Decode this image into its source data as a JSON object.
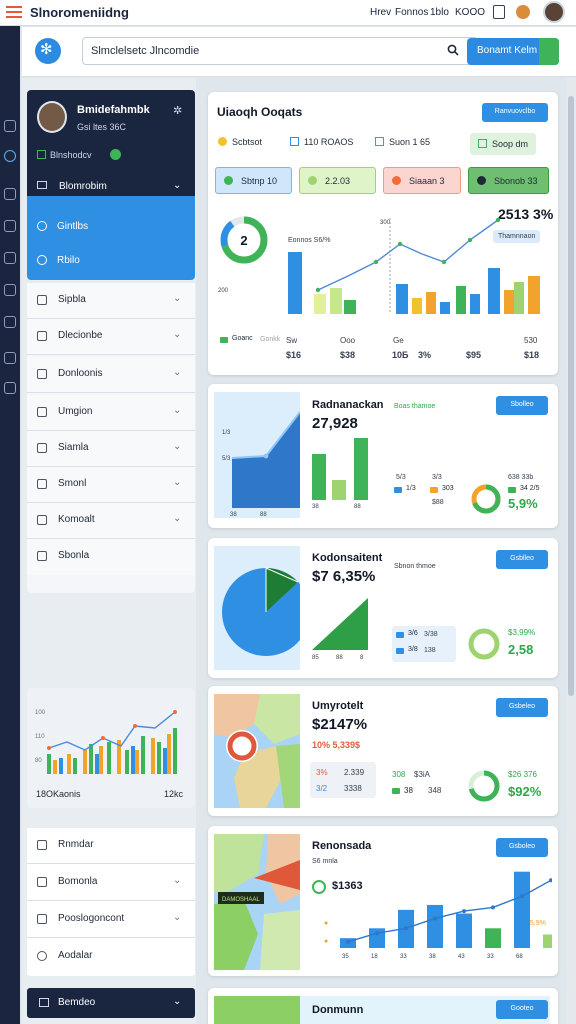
{
  "topbar": {
    "title": "Slnoromeniidng",
    "links": [
      "Hrev",
      "Fonnos",
      "1blo",
      "KOOO"
    ]
  },
  "search": {
    "value": "Slmclelsetc Jlncomdie",
    "button_label": "Bonamt Kelm"
  },
  "profile": {
    "name": "Bmidefahmbk",
    "sub": "Gsi ltes 36C",
    "status": "Blnshodcv",
    "menu_label": "Blomrobim",
    "items": [
      "Gintlbs",
      "Rbilo"
    ]
  },
  "nav": {
    "items": [
      "Sipbla",
      "Dlecionbe",
      "Donloonis",
      "Umgion",
      "Siamla",
      "Smonl",
      "Komoalt",
      "Sbonla"
    ],
    "bottom_items": [
      "Rnmdar",
      "Bomonla",
      "Pooslogoncont",
      "Aodalar"
    ],
    "footer_label": "Bemdeo"
  },
  "side_chart": {
    "label": "18OKaonis",
    "value": "12kc",
    "axis": [
      "100",
      "110",
      "80"
    ]
  },
  "card1": {
    "title": "Uiaoqh Ooqats",
    "button": "Ranvuovclbo",
    "tabs": [
      "Scbtsot",
      "110 ROAOS",
      "Suon 1 65",
      "Soop dm"
    ],
    "chips": [
      "Sbtnp 10",
      "2.2.03",
      "Siaaan 3",
      "Sbonob 33"
    ],
    "stat": "2513 3%",
    "donut_label": "2",
    "legend_left": "Eonnos S6/%",
    "legend_right": "Thamnnaon",
    "axis_top": "300",
    "axis_left": "200",
    "pills": [
      "Goanc",
      "Gonkk"
    ],
    "xvals": [
      "$16",
      "$38",
      "10Б",
      "3%",
      "$95",
      "$18"
    ],
    "xtop": [
      "Sw",
      "Ooo",
      "Ge",
      "530"
    ]
  },
  "card2": {
    "title": "Radnanackan",
    "value": "27,928",
    "tag": "Boas thamoe",
    "button": "Sbolleo",
    "ylabels": [
      "1/3",
      "5/3"
    ],
    "xlabels": [
      "38",
      "88"
    ],
    "mid_labels": [
      "5/3",
      "3/3"
    ],
    "pills": [
      "1/3",
      "303",
      "3/4",
      "$88"
    ],
    "right_tags": [
      "638 33b",
      "34 2/5"
    ],
    "donut_value": "5,9%"
  },
  "card3": {
    "title": "Kodonsaitent",
    "value": "$7 6,35%",
    "tag": "Sbnon thmoe",
    "button": "Gsblleo",
    "pills": [
      "3/6",
      "3/38",
      "3/8",
      "138"
    ],
    "right_tag": "$3,99%",
    "donut_value": "2,58",
    "xlabels": [
      "85",
      "88",
      "8"
    ]
  },
  "card4": {
    "title": "Umyrotelt",
    "value": "$2147%",
    "sub": "10% 5,339$",
    "button": "Gsbeleo",
    "pills": [
      "3%",
      "2.339",
      "3/2",
      "3338"
    ],
    "mid": [
      "308",
      "$3iA",
      "38",
      "348"
    ],
    "right_tag": "$26 376",
    "donut_value": "$92%"
  },
  "card5": {
    "title": "Renonsada",
    "sub": "S6 mnla",
    "value": "$1363",
    "map_tag": "DAMOSHAAL",
    "button": "Gsboleo",
    "xlabels": [
      "35",
      "18",
      "33",
      "38",
      "43",
      "33",
      "68"
    ],
    "right_tag": "85,9%",
    "chart_data": {
      "type": "bar",
      "values": [
        8,
        16,
        31,
        35,
        28,
        16,
        62,
        11
      ],
      "line": [
        5,
        12,
        16,
        24,
        30,
        33,
        42,
        55
      ]
    }
  },
  "card6": {
    "title": "Donmunn",
    "button": "Gooteo"
  }
}
